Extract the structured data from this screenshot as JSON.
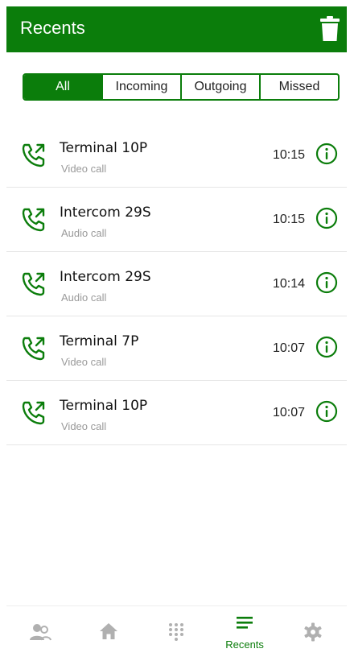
{
  "header": {
    "title": "Recents"
  },
  "filters": [
    {
      "label": "All",
      "active": true
    },
    {
      "label": "Incoming",
      "active": false
    },
    {
      "label": "Outgoing",
      "active": false
    },
    {
      "label": "Missed",
      "active": false
    }
  ],
  "calls": [
    {
      "name": "Terminal 10P",
      "type": "Video call",
      "time": "10:15"
    },
    {
      "name": "Intercom 29S",
      "type": "Audio call",
      "time": "10:15"
    },
    {
      "name": "Intercom 29S",
      "type": "Audio call",
      "time": "10:14"
    },
    {
      "name": "Terminal 7P",
      "type": "Video call",
      "time": "10:07"
    },
    {
      "name": "Terminal 10P",
      "type": "Video call",
      "time": "10:07"
    }
  ],
  "nav": {
    "recents_label": "Recents"
  },
  "icons": {
    "delete": "trash-icon",
    "call": "outgoing-call-icon",
    "info": "info-icon",
    "contacts": "contacts-icon",
    "home": "home-icon",
    "dialpad": "dialpad-icon",
    "recents": "recents-list-icon",
    "settings": "gear-icon"
  },
  "colors": {
    "brand": "#0b7d0b",
    "inactive_icon": "#b0b0b0",
    "secondary_text": "#9a9a9a"
  }
}
